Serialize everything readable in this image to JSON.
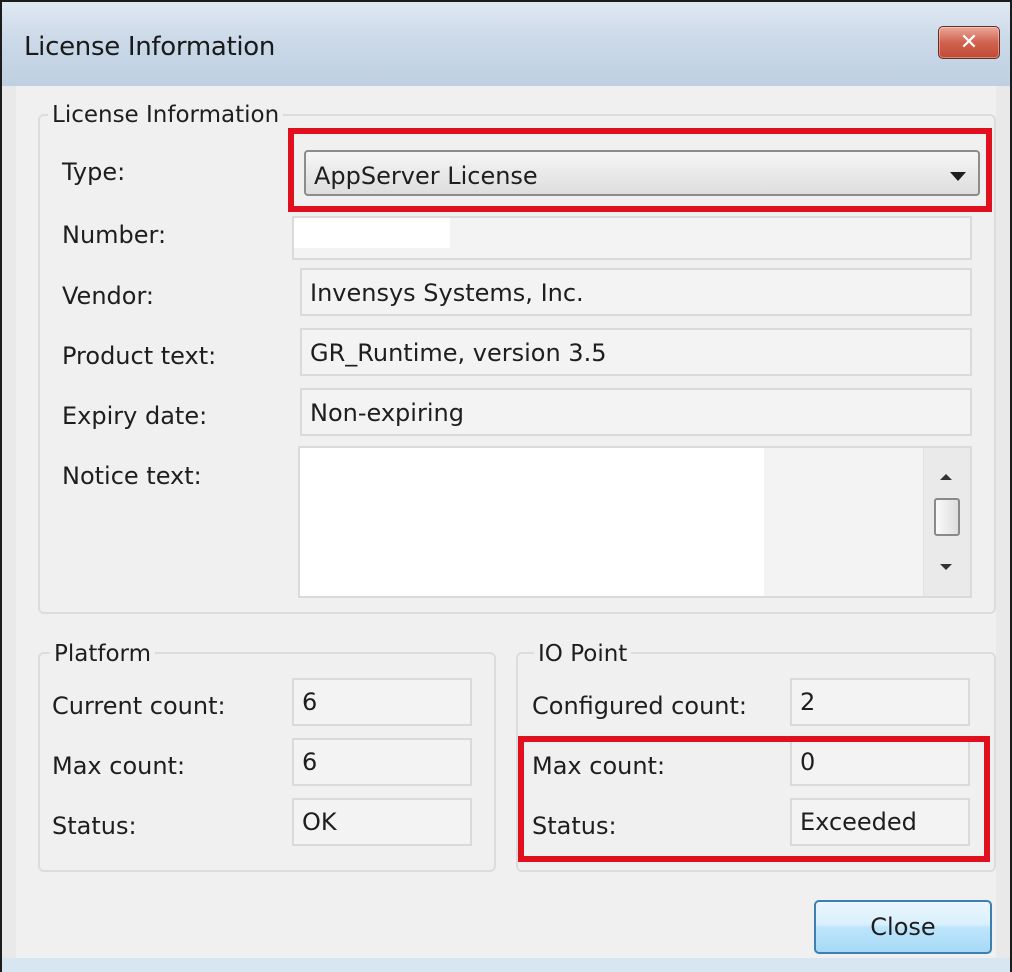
{
  "window": {
    "title": "License Information",
    "close_glyph": "✕"
  },
  "license": {
    "group_label": "License Information",
    "type_label": "Type:",
    "type_value": "AppServer License",
    "number_label": "Number:",
    "number_value": "",
    "vendor_label": "Vendor:",
    "vendor_value": "Invensys Systems, Inc.",
    "product_label": "Product text:",
    "product_value": "GR_Runtime, version 3.5",
    "expiry_label": "Expiry date:",
    "expiry_value": "Non-expiring",
    "notice_label": "Notice text:",
    "notice_value": ""
  },
  "platform": {
    "group_label": "Platform",
    "current_label": "Current count:",
    "current_value": "6",
    "max_label": "Max count:",
    "max_value": "6",
    "status_label": "Status:",
    "status_value": "OK"
  },
  "io_point": {
    "group_label": "IO Point",
    "configured_label": "Configured count:",
    "configured_value": "2",
    "max_label": "Max count:",
    "max_value": "0",
    "status_label": "Status:",
    "status_value": "Exceeded"
  },
  "buttons": {
    "close_label": "Close"
  },
  "colors": {
    "highlight": "#e0101e",
    "close_x_button": "#c04a34",
    "titlebar": "#cbd9e8"
  }
}
